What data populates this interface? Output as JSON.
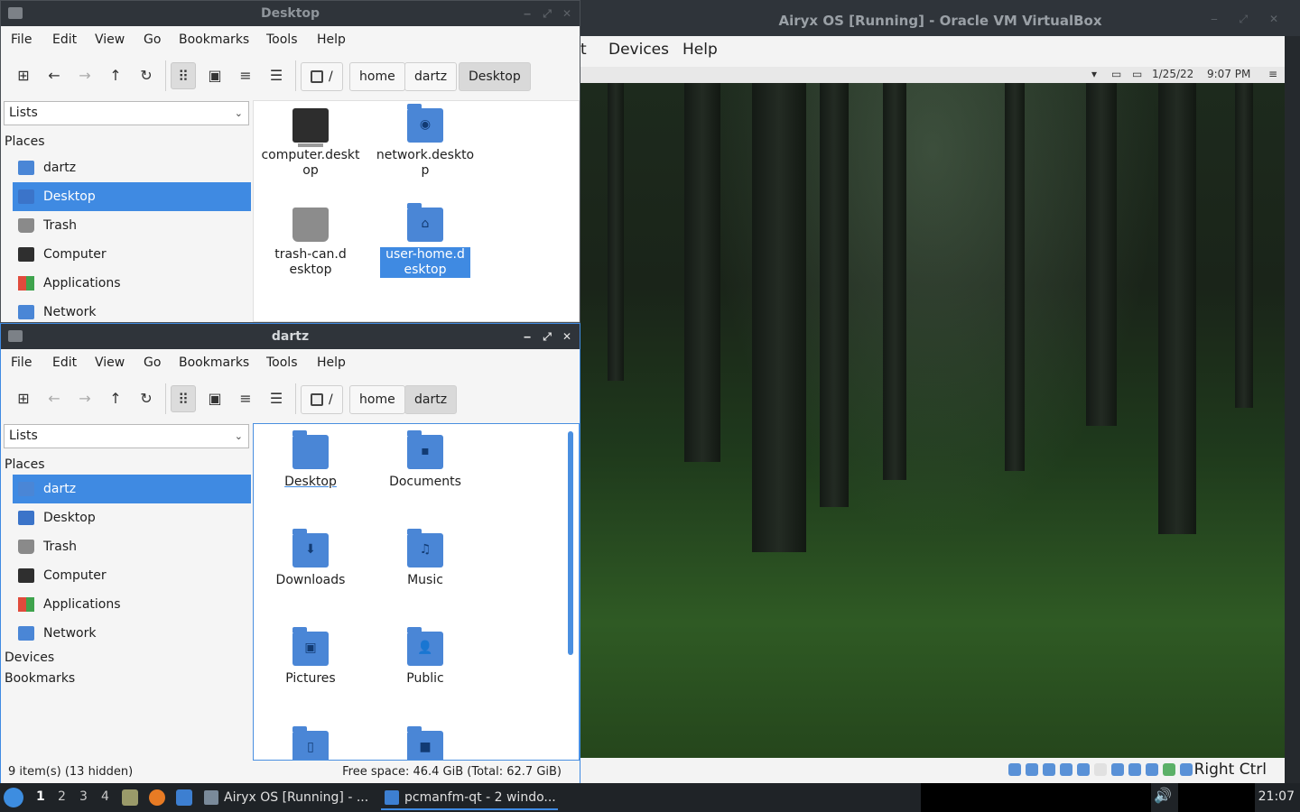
{
  "vbox": {
    "title": "Airyx OS [Running] - Oracle VM VirtualBox",
    "menu": [
      "t",
      "Devices",
      "Help"
    ],
    "guest_panel": {
      "date": "1/25/22",
      "time": "9:07 PM"
    },
    "host_key": "Right Ctrl"
  },
  "desktop_window": {
    "title": "Desktop",
    "menu": [
      "File",
      "Edit",
      "View",
      "Go",
      "Bookmarks",
      "Tools",
      "Help"
    ],
    "breadcrumbs": [
      "/",
      "home",
      "dartz",
      "Desktop"
    ],
    "sidebar_combo": "Lists",
    "places_heading": "Places",
    "places": [
      "dartz",
      "Desktop",
      "Trash",
      "Computer",
      "Applications",
      "Network"
    ],
    "selected_place": "Desktop",
    "files": [
      "computer.desktop",
      "network.desktop",
      "trash-can.desktop",
      "user-home.desktop"
    ]
  },
  "dartz_window": {
    "title": "dartz",
    "menu": [
      "File",
      "Edit",
      "View",
      "Go",
      "Bookmarks",
      "Tools",
      "Help"
    ],
    "breadcrumbs": [
      "/",
      "home",
      "dartz"
    ],
    "sidebar_combo": "Lists",
    "places_heading": "Places",
    "places": [
      "dartz",
      "Desktop",
      "Trash",
      "Computer",
      "Applications",
      "Network"
    ],
    "selected_place": "dartz",
    "devices_heading": "Devices",
    "bookmarks_heading": "Bookmarks",
    "files": [
      "Desktop",
      "Documents",
      "Downloads",
      "Music",
      "Pictures",
      "Public"
    ],
    "status_left": "9 item(s) (13 hidden)",
    "status_right": "Free space: 46.4 GiB (Total: 62.7 GiB)"
  },
  "taskbar": {
    "desktops": [
      "1",
      "2",
      "3",
      "4"
    ],
    "active_desktop": "1",
    "tasks": [
      "Airyx OS [Running] - ...",
      "pcmanfm-qt - 2 windo..."
    ],
    "clock": "21:07"
  },
  "colors": {
    "selection": "#3f8ae2",
    "folder": "#4a86d6",
    "titlebar": "#2f343a"
  }
}
